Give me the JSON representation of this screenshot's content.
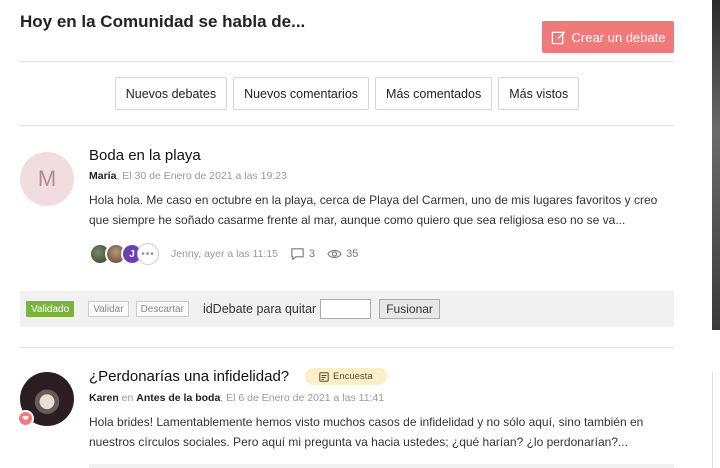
{
  "header": {
    "title": "Hoy en la Comunidad se habla de...",
    "create_label": "Crear un debate"
  },
  "tabs": [
    {
      "label": "Nuevos debates"
    },
    {
      "label": "Nuevos comentarios"
    },
    {
      "label": "Más comentados"
    },
    {
      "label": "Más vistos"
    }
  ],
  "posts": [
    {
      "avatar_letter": "M",
      "title": "Boda en la playa",
      "author": "María",
      "date": ", El 30 de Enero de 2021 a las 19:23",
      "excerpt": "Hola hola. Me caso en octubre en la playa, cerca de Playa del Carmen, uno de mis lugares favoritos y creo que siempre he soñado casarme frente al mar, aunque como quiero que sea religiosa eso no se va...",
      "participant_letter": "J",
      "more_label": "•••",
      "last_activity": "Jenny, ayer a las 11:15",
      "comments": "3",
      "views": "35",
      "moderation": {
        "validated_label": "Validado",
        "validate_label": "Validar",
        "discard_label": "Descartar",
        "id_label": "idDebate para quitar",
        "merge_label": "Fusionar"
      }
    },
    {
      "title": "¿Perdonarías una infidelidad?",
      "badge": "Encuesta",
      "author": "Karen",
      "in_label": " en ",
      "category": "Antes de la boda",
      "date": ", El 6 de Enero de 2021 a las 11:41",
      "excerpt": "Hola brides! Lamentablemente hemos visto muchos casos de infidelidad y no sólo aquí, sino también en nuestros círculos sociales. Pero aquí mi pregunta va hacia ustedes; ¿qué harían? ¿lo perdonarían?..."
    }
  ],
  "colors": {
    "accent": "#f0797a",
    "validated": "#7bb33b",
    "poll_badge": "#fbeec9"
  }
}
